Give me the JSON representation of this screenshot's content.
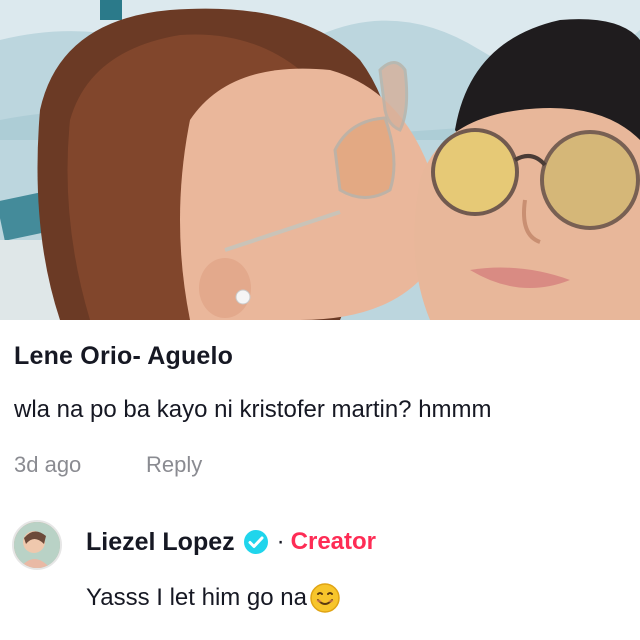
{
  "photo": {
    "description_icon": "photo-image"
  },
  "comment1": {
    "author": "Lene Orio- Aguelo",
    "text": "wla na po ba kayo ni kristofer martin? hmmm",
    "time": "3d ago",
    "reply_label": "Reply"
  },
  "comment2": {
    "author": "Liezel Lopez",
    "verified_icon": "verified-badge-icon",
    "separator": "·",
    "badge": "Creator",
    "text": "Yasss I let him go na",
    "emoji_icon": "smiling-face-emoji"
  },
  "colors": {
    "text_primary": "#161823",
    "text_secondary": "#8a8b91",
    "creator_accent": "#fe2c55",
    "verified_blue": "#20d5ec"
  }
}
